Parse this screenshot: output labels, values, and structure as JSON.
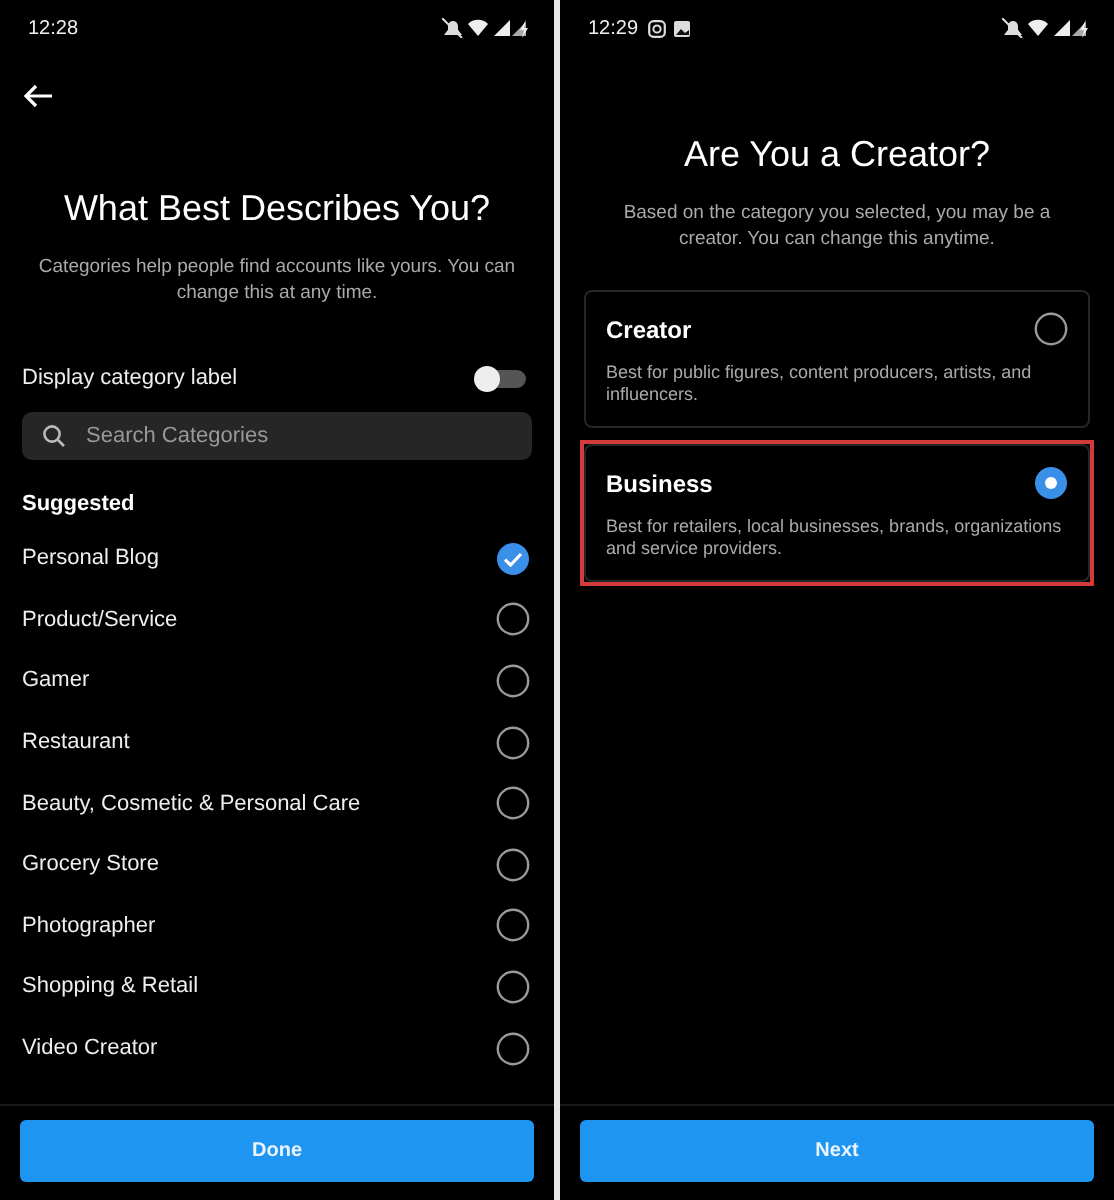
{
  "left_screen": {
    "status_bar": {
      "time": "12:28"
    },
    "title": "What Best Describes You?",
    "subtitle": "Categories help people find accounts like yours. You can change this at any time.",
    "display_label_toggle": {
      "label": "Display category label",
      "on": false
    },
    "search": {
      "placeholder": "Search Categories"
    },
    "section_heading": "Suggested",
    "categories": [
      {
        "label": "Personal Blog",
        "selected": true
      },
      {
        "label": "Product/Service",
        "selected": false
      },
      {
        "label": "Gamer",
        "selected": false
      },
      {
        "label": "Restaurant",
        "selected": false
      },
      {
        "label": "Beauty, Cosmetic & Personal Care",
        "selected": false
      },
      {
        "label": "Grocery Store",
        "selected": false
      },
      {
        "label": "Photographer",
        "selected": false
      },
      {
        "label": "Shopping & Retail",
        "selected": false
      },
      {
        "label": "Video Creator",
        "selected": false
      }
    ],
    "button": "Done"
  },
  "right_screen": {
    "status_bar": {
      "time": "12:29"
    },
    "title": "Are You a Creator?",
    "subtitle": "Based on the category you selected, you may be a creator. You can change this anytime.",
    "account_types": [
      {
        "title": "Creator",
        "description": "Best for public figures, content producers, artists, and influencers.",
        "selected": false,
        "highlighted": false
      },
      {
        "title": "Business",
        "description": "Best for retailers, local businesses, brands, organizations and service providers.",
        "selected": true,
        "highlighted": true
      }
    ],
    "button": "Next"
  }
}
